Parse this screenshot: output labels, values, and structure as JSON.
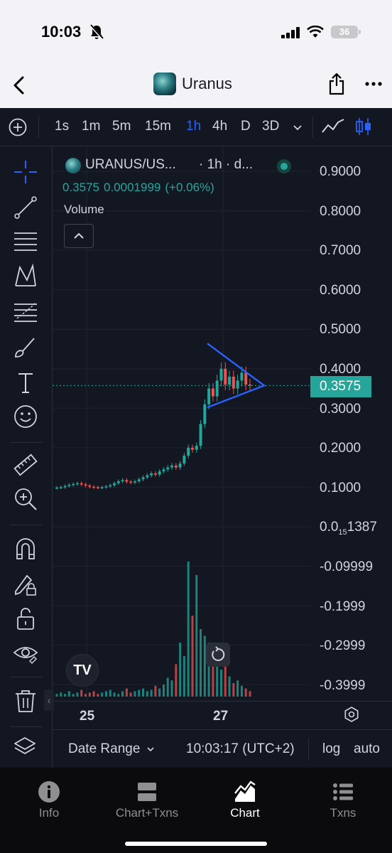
{
  "status": {
    "time": "10:03",
    "battery": "36"
  },
  "nav": {
    "title": "Uranus"
  },
  "toolbar": {
    "timeframes": [
      {
        "label": "1s",
        "active": false
      },
      {
        "label": "1m",
        "active": false
      },
      {
        "label": "5m",
        "active": false
      },
      {
        "label": "15m",
        "active": false
      },
      {
        "label": "1h",
        "active": true
      },
      {
        "label": "4h",
        "active": false
      },
      {
        "label": "D",
        "active": false
      },
      {
        "label": "3D",
        "active": false
      }
    ]
  },
  "legend": {
    "symbol": "URANUS/US...",
    "interval": "· 1h · d...",
    "last": "0.3575",
    "change": "0.0001999",
    "change_pct": "(+0.06%)",
    "volume_label": "Volume"
  },
  "price_axis": {
    "labels": [
      "0.9000",
      "0.8000",
      "0.7000",
      "0.6000",
      "0.5000",
      "0.4000",
      "0.3000",
      "0.2000",
      "0.1000"
    ],
    "small_label_prefix": "0.0",
    "small_label_sub": "15",
    "small_label_suffix": "1387",
    "negative_labels": [
      "-0.09999",
      "-0.1999",
      "-0.2999",
      "-0.3999"
    ],
    "last_price": "0.3575"
  },
  "x_axis": {
    "labels": [
      "25",
      "27"
    ]
  },
  "bottom": {
    "date_range": "Date Range",
    "clock": "10:03:17 (UTC+2)",
    "log": "log",
    "auto": "auto"
  },
  "tabs": [
    {
      "label": "Info",
      "icon": "info-icon",
      "active": false
    },
    {
      "label": "Chart+Txns",
      "icon": "split-view-icon",
      "active": false
    },
    {
      "label": "Chart",
      "icon": "chart-icon",
      "active": true
    },
    {
      "label": "Txns",
      "icon": "list-icon",
      "active": false
    }
  ],
  "colors": {
    "up": "#26a69a",
    "down": "#ef5350",
    "active_timeframe": "#2962ff",
    "pattern": "#2962ff",
    "background": "#131722"
  },
  "chart_data": {
    "type": "candlestick",
    "symbol": "URANUS/USD",
    "interval": "1h",
    "last_price": 0.3575,
    "y_range": [
      -0.4,
      0.92
    ],
    "x_ticks": [
      "25",
      "27"
    ],
    "close_series": [
      0.099,
      0.1,
      0.103,
      0.106,
      0.108,
      0.11,
      0.107,
      0.104,
      0.101,
      0.1,
      0.099,
      0.1,
      0.102,
      0.105,
      0.11,
      0.115,
      0.118,
      0.114,
      0.112,
      0.115,
      0.12,
      0.125,
      0.13,
      0.135,
      0.132,
      0.14,
      0.145,
      0.15,
      0.155,
      0.15,
      0.16,
      0.18,
      0.2,
      0.195,
      0.205,
      0.26,
      0.31,
      0.35,
      0.33,
      0.37,
      0.4,
      0.36,
      0.38,
      0.35,
      0.37,
      0.39,
      0.36,
      0.3575
    ],
    "volume_series": [
      2,
      3,
      2,
      4,
      2,
      3,
      5,
      2,
      3,
      4,
      2,
      3,
      4,
      5,
      3,
      2,
      4,
      6,
      3,
      4,
      5,
      6,
      4,
      5,
      8,
      6,
      9,
      14,
      12,
      24,
      40,
      30,
      100,
      60,
      90,
      50,
      45,
      40,
      25,
      30,
      20,
      35,
      15,
      10,
      12,
      8,
      6,
      4
    ],
    "patterns": [
      {
        "type": "symmetrical-triangle",
        "color": "#2962ff"
      }
    ]
  }
}
